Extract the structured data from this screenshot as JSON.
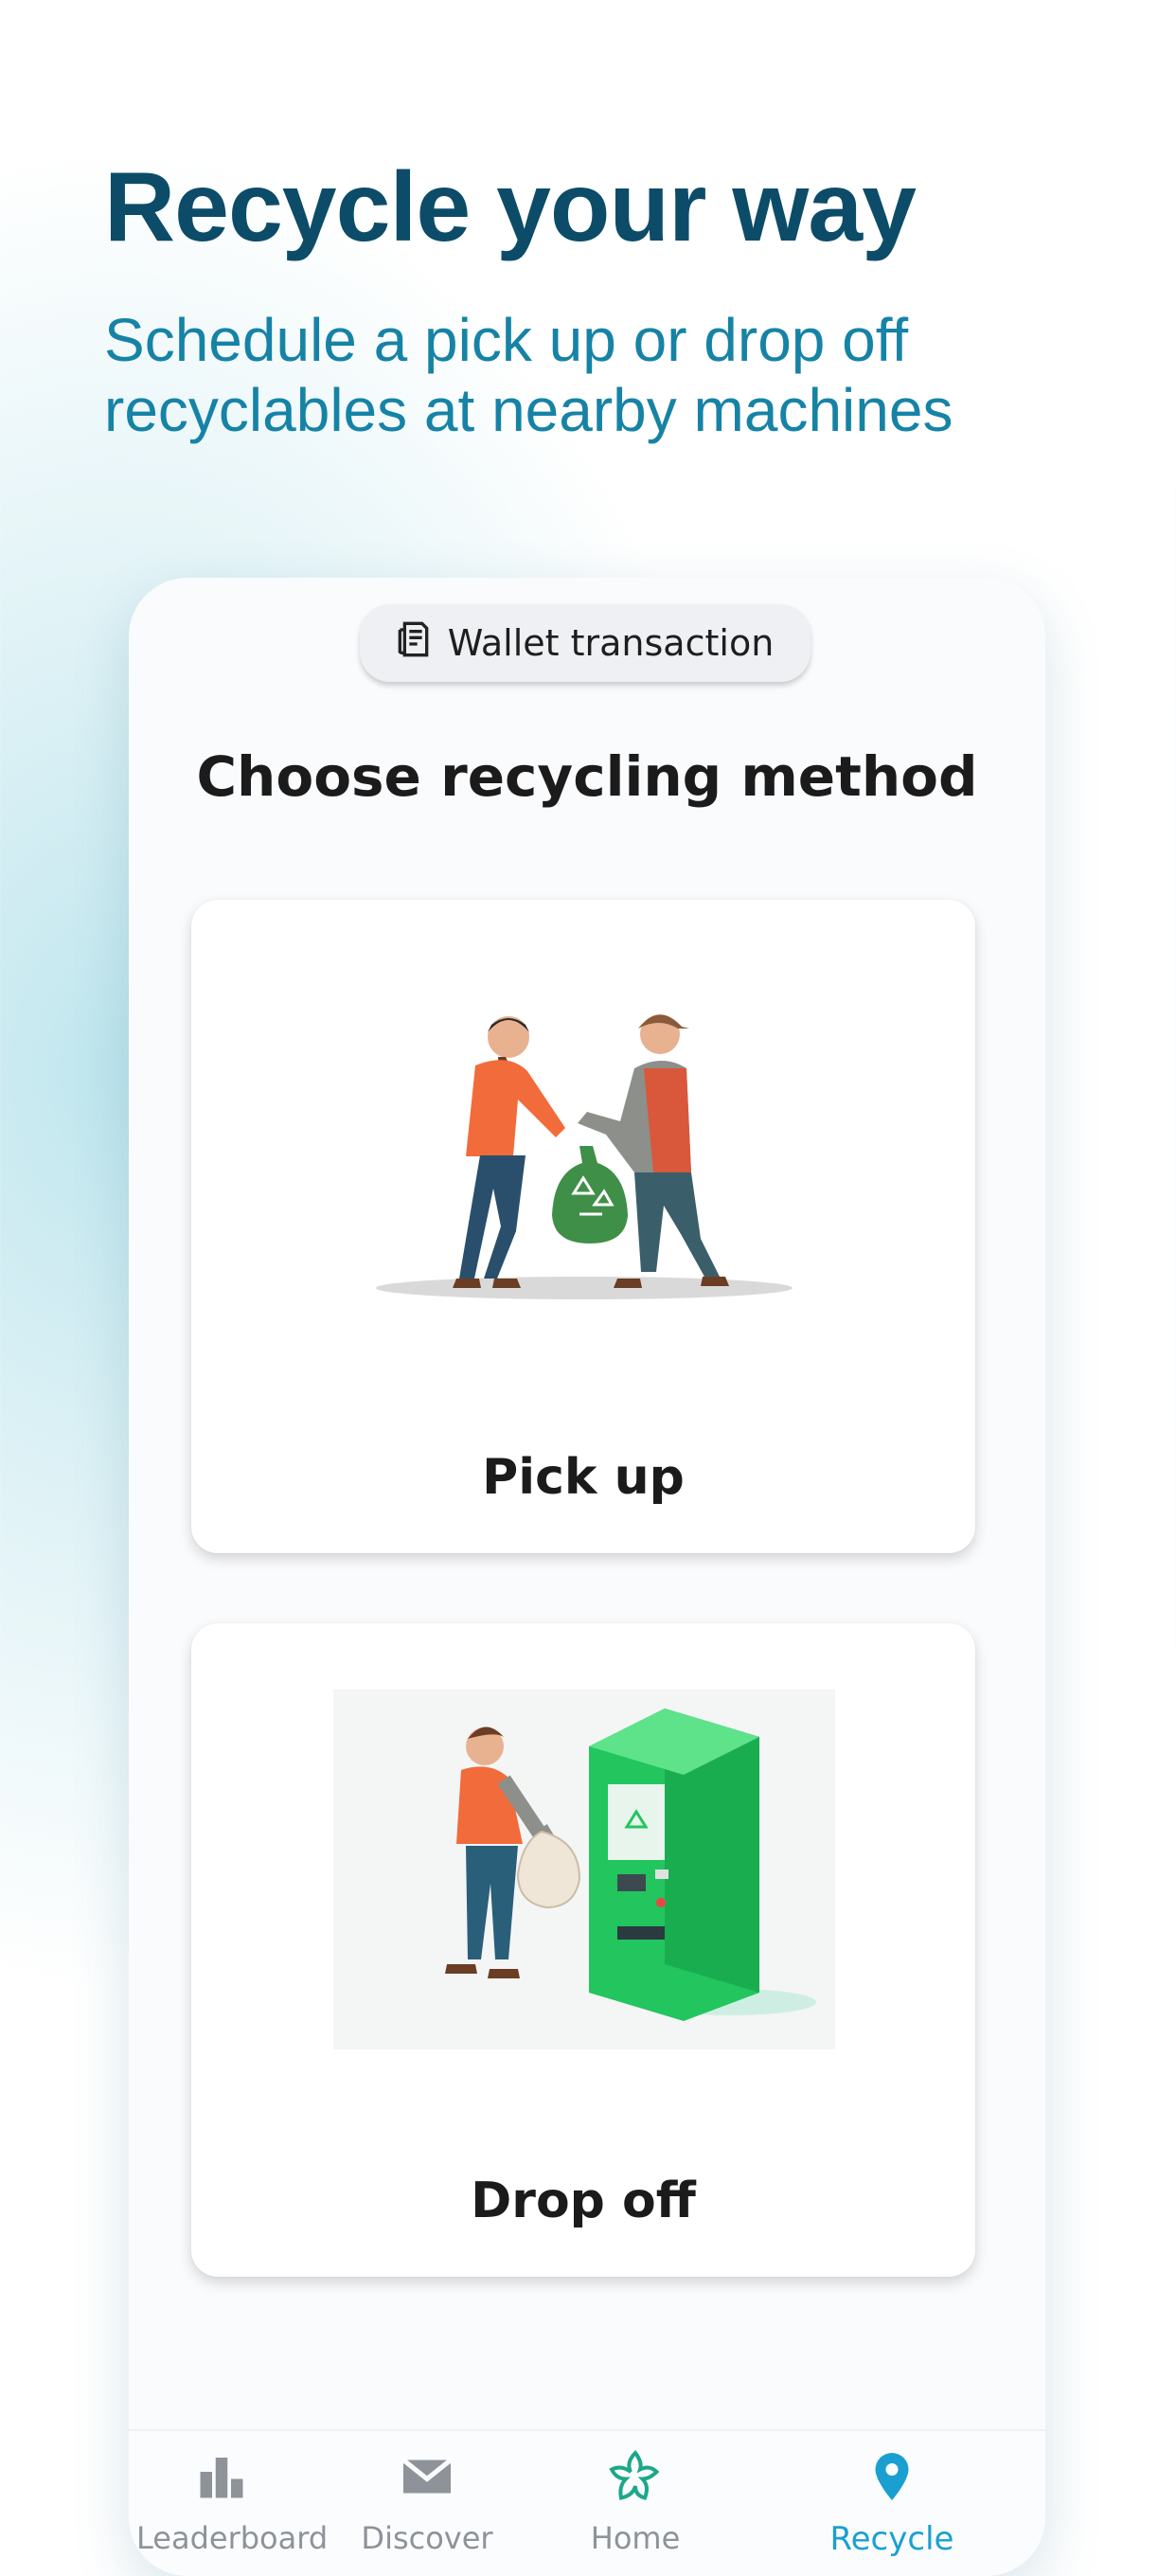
{
  "header": {
    "title": "Recycle your way",
    "subtitle": "Schedule a pick up or drop off recyclables at nearby machines"
  },
  "wallet": {
    "label": "Wallet transaction",
    "icon": "receipt-icon"
  },
  "main": {
    "title": "Choose recycling method",
    "methods": [
      {
        "label": "Pick up",
        "illustration": "pickup-illustration"
      },
      {
        "label": "Drop off",
        "illustration": "dropoff-machine-illustration"
      }
    ]
  },
  "nav": {
    "items": [
      {
        "label": "Leaderboard",
        "icon": "leaderboard-icon",
        "active": false
      },
      {
        "label": "Discover",
        "icon": "envelope-icon",
        "active": false
      },
      {
        "label": "Home",
        "icon": "home-logo-icon",
        "active": false
      },
      {
        "label": "Recycle",
        "icon": "location-pin-icon",
        "active": true
      }
    ]
  },
  "colors": {
    "heading": "#0c4c68",
    "subheading": "#1683a6",
    "accent": "#1aa0d0",
    "inactive_nav": "#8d9398",
    "machine_green": "#22c55e"
  }
}
